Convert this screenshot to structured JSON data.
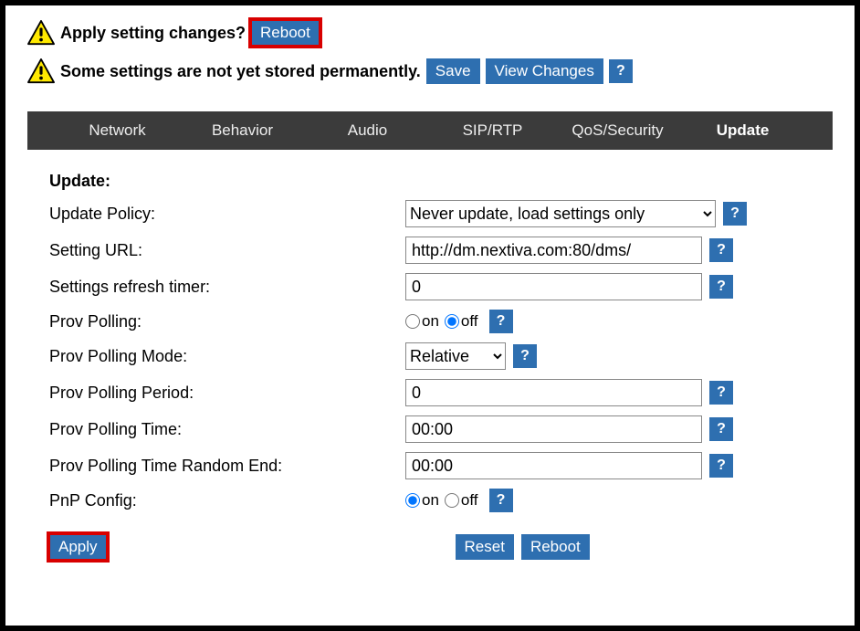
{
  "alerts": {
    "apply_changes_text": "Apply setting changes?",
    "reboot_label": "Reboot",
    "not_stored_text": "Some settings are not yet stored permanently.",
    "save_label": "Save",
    "view_changes_label": "View Changes"
  },
  "nav": {
    "items": [
      {
        "label": "Network",
        "active": false
      },
      {
        "label": "Behavior",
        "active": false
      },
      {
        "label": "Audio",
        "active": false
      },
      {
        "label": "SIP/RTP",
        "active": false
      },
      {
        "label": "QoS/Security",
        "active": false
      },
      {
        "label": "Update",
        "active": true
      }
    ]
  },
  "section": {
    "title": "Update:"
  },
  "form": {
    "update_policy": {
      "label": "Update Policy:",
      "value": "Never update, load settings only"
    },
    "setting_url": {
      "label": "Setting URL:",
      "value": "http://dm.nextiva.com:80/dms/"
    },
    "refresh_timer": {
      "label": "Settings refresh timer:",
      "value": "0"
    },
    "prov_polling": {
      "label": "Prov Polling:",
      "on_label": "on",
      "off_label": "off",
      "value": "off"
    },
    "prov_polling_mode": {
      "label": "Prov Polling Mode:",
      "value": "Relative"
    },
    "prov_polling_period": {
      "label": "Prov Polling Period:",
      "value": "0"
    },
    "prov_polling_time": {
      "label": "Prov Polling Time:",
      "value": "00:00"
    },
    "prov_polling_time_random_end": {
      "label": "Prov Polling Time Random End:",
      "value": "00:00"
    },
    "pnp_config": {
      "label": "PnP Config:",
      "on_label": "on",
      "off_label": "off",
      "value": "on"
    }
  },
  "actions": {
    "apply_label": "Apply",
    "reset_label": "Reset",
    "reboot_label": "Reboot"
  },
  "help_symbol": "?"
}
